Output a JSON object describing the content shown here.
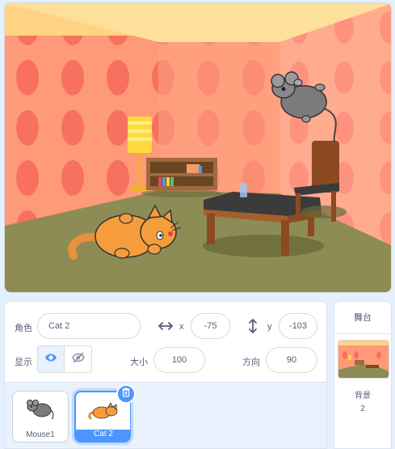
{
  "sprite_info": {
    "sprite_label": "角色",
    "sprite_name": "Cat 2",
    "x_label": "x",
    "x_value": "-75",
    "y_label": "y",
    "y_value": "-103",
    "show_label": "显示",
    "visible": true,
    "size_label": "大小",
    "size_value": "100",
    "direction_label": "方向",
    "direction_value": "90"
  },
  "sprites": [
    {
      "name": "Mouse1",
      "selected": false
    },
    {
      "name": "Cat 2",
      "selected": true
    }
  ],
  "stage_pane": {
    "title": "舞台",
    "backdrops_label": "背景",
    "backdrops_count": "2"
  },
  "colors": {
    "accent": "#4c97ff",
    "panel_bg": "#e9f1fc",
    "text": "#575e75"
  },
  "icons": [
    "drag-handle-horizontal-icon",
    "drag-handle-vertical-icon",
    "eye-icon",
    "eye-slash-icon",
    "trash-icon"
  ]
}
